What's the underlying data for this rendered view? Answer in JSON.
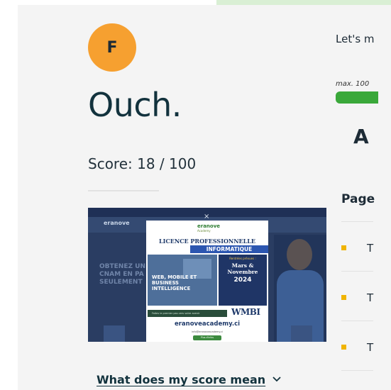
{
  "report": {
    "grade_letter": "F",
    "headline": "Ouch.",
    "score_text": "Score: 18 / 100",
    "score_value": 18,
    "score_max": 100,
    "what_link": "What does my score mean",
    "chevron_icon": "chevron-down-icon"
  },
  "preview": {
    "close_glyph": "×",
    "site_logo": "eranove",
    "side_text": "OBTENEZ UN CNAM EN PA SEULEMENT",
    "flyer": {
      "logo": "eranove",
      "logo_sub": "Academy",
      "title1": "LICENCE PROFESSIONNELLE",
      "title2": "INFORMATIQUE",
      "image_text": "WEB, MOBILE ET BUSINESS INTELLIGENCE",
      "box_a": "Rentrées prévues :",
      "box_b": "Mars & Novembre",
      "box_c": "2024",
      "bar_text": "Faites le premier pas vers votre avenir",
      "wmbi": "WMBI",
      "url": "eranoveacademy.ci",
      "mail": "info@eranoveacademy.ci",
      "button": "Plus d'infos"
    }
  },
  "right": {
    "intro": "Let's m",
    "max_label": "max. 100",
    "grade": "A",
    "page_label": "Page",
    "bullet_letter": "T"
  },
  "colors": {
    "grade_circle": "#f6a030",
    "accent_green": "#3aa83a",
    "bullet_yellow": "#f0b400",
    "headline_text": "#12323d"
  }
}
